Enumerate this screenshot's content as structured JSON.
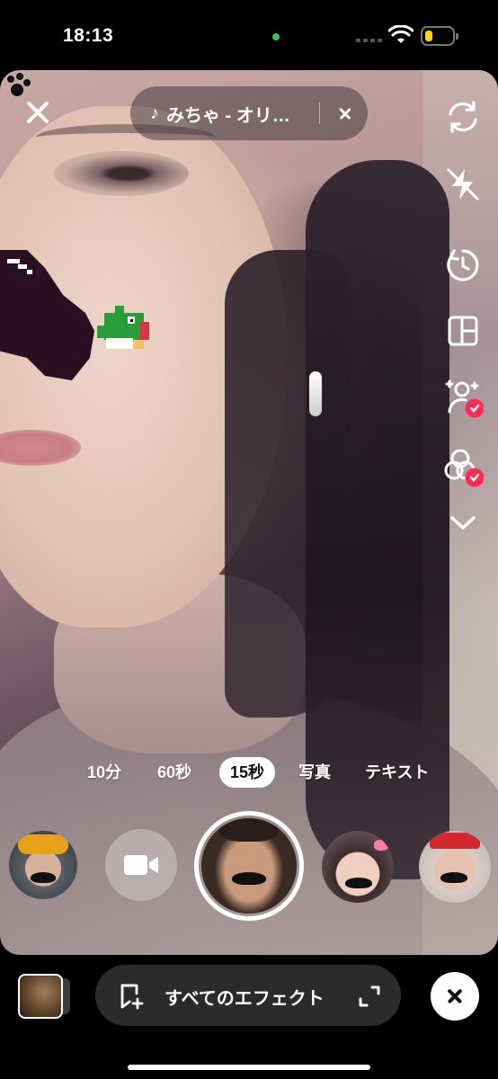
{
  "status_bar": {
    "time": "18:13",
    "camera_indicator_color": "#34c759",
    "battery_color": "#ffd60a"
  },
  "top": {
    "close_icon": "close-icon",
    "music": {
      "note_icon": "music-note-icon",
      "title": "みちゃ - オリ…",
      "clear_icon": "clear-icon"
    }
  },
  "toolbar": [
    {
      "name": "flip-camera-icon"
    },
    {
      "name": "flash-off-icon"
    },
    {
      "name": "timer-icon"
    },
    {
      "name": "layout-icon"
    },
    {
      "name": "beauty-icon",
      "checked": true
    },
    {
      "name": "filters-icon",
      "checked": true
    },
    {
      "name": "chevron-down-icon"
    }
  ],
  "modes": {
    "items": [
      "10分",
      "60秒",
      "15秒",
      "写真",
      "テキスト"
    ],
    "active": "15秒"
  },
  "bottom": {
    "effects_label": "すべてのエフェクト",
    "accent_color": "#fe2c55"
  }
}
